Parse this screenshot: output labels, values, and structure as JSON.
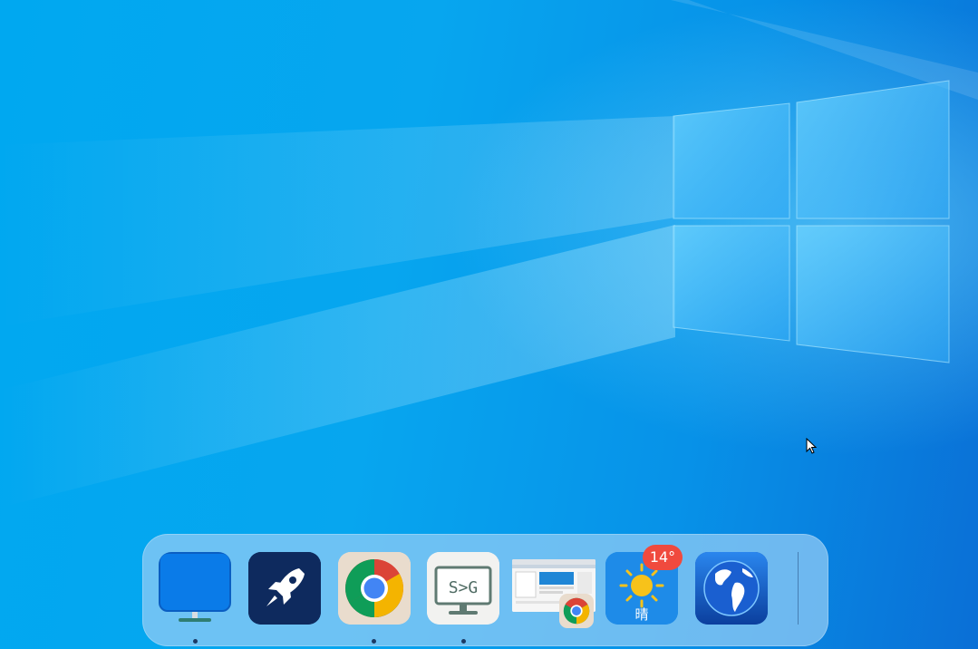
{
  "desktop": {
    "wallpaper": "windows-10-hero",
    "colors": {
      "accent": "#07a6ef",
      "logo_light": "#9fe4ff"
    }
  },
  "dock": {
    "items": [
      {
        "id": "desktop",
        "icon": "monitor-icon",
        "running": true
      },
      {
        "id": "launcher",
        "icon": "rocket-icon",
        "running": false
      },
      {
        "id": "chrome",
        "icon": "chrome-icon",
        "running": true
      },
      {
        "id": "sg",
        "icon": "sg-monitor-icon",
        "running": true
      },
      {
        "id": "chrome-window",
        "icon": "window-thumbnail",
        "running": false
      },
      {
        "id": "weather",
        "icon": "sun-icon",
        "running": false
      },
      {
        "id": "globe",
        "icon": "globe-icon",
        "running": false
      }
    ],
    "sg_label": "S>G",
    "weather": {
      "temperature": "14°",
      "condition": "晴",
      "badge_color": "#f04a3e"
    }
  }
}
